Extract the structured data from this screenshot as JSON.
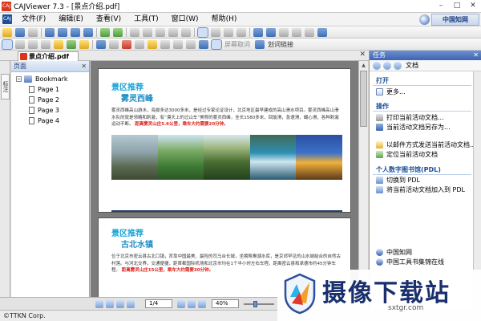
{
  "window": {
    "app_icon": "CAJ",
    "title": "CAJViewer 7.3 - [景点介绍.pdf]",
    "buttons": [
      "–",
      "□",
      "✕"
    ]
  },
  "menubar": {
    "logo": "CAJ",
    "items": [
      "文件(F)",
      "编辑(E)",
      "查看(V)",
      "工具(T)",
      "窗口(W)",
      "帮助(H)"
    ],
    "mdi_buttons": [
      "–",
      "□",
      "✕"
    ],
    "brand": "中国知网"
  },
  "toolbar2": {
    "screen_capture_label": "屏幕取词",
    "highlight_link_label": "划词链接"
  },
  "document_tab": {
    "label": "景点介绍.pdf",
    "close": "✕"
  },
  "left_strip": {
    "tab_label": "标注"
  },
  "pages_panel": {
    "header": "页面",
    "close": "✕",
    "root": "Bookmark",
    "items": [
      "Page 1",
      "Page 2",
      "Page 3",
      "Page 4"
    ]
  },
  "document": {
    "section1": {
      "heading": "景区推荐",
      "subheading": "雾灵西峰",
      "body_plain": "雾灵西峰高山游水，海拔多达3000多米，是经过专家论证设计，北京地区最早建成的高山滑水项目。雾灵西峰高山滑水队的就是领略和刺激，有“漠天上的过山车”美称的雾灵西峰，全长1580多米，回旋滑，急速滑，蝴心滑，各种刺激运动不断。",
      "body_red": "距离雾灵山庄5.6公里，乘车大约需要20分钟。"
    },
    "section2": {
      "heading": "景区推荐",
      "subheading": "古北水镇",
      "body_plain": "位于北京市密云县古北口镇，背靠中国最美、最险的司马台长城，坐拥鸳鸯湖水库，是京郊罕见的山水城结合的自然古村落。与河北交界，交通便捷，距首都国际机场和北京市均在1个半小时左右车程，距离密云县和承德市约45分钟车程。",
      "body_red": "距离雾灵山庄15公里，乘车大约需要30分钟。"
    }
  },
  "statusbar": {
    "page": "1/4",
    "zoom": "40%"
  },
  "footer": {
    "copyright": "©TTKN Corp."
  },
  "task_pane": {
    "header": "任务",
    "close": "✕",
    "nav_label": "文档",
    "open": {
      "title": "打开",
      "more": "更多..."
    },
    "operations": {
      "title": "操作",
      "links": [
        "打印当前活动文档...",
        "当前活动文档另存为...",
        "以邮件方式发送当前活动文档...",
        "定位当前活动文档"
      ]
    },
    "pdl": {
      "title": "个人数字图书馆(PDL)",
      "links": [
        "切换到 PDL",
        "将当前活动文档加入到 PDL"
      ]
    },
    "bottom_links": [
      "中国知网",
      "中国工具书集锦在线"
    ]
  },
  "watermark": {
    "text": "摄像下载站",
    "url": "sxtgr.com"
  }
}
